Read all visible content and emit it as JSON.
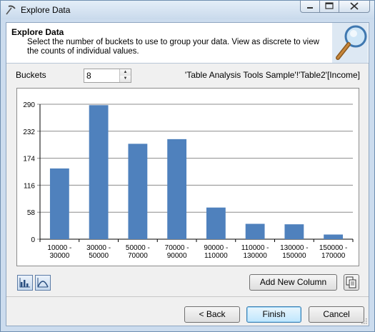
{
  "window": {
    "title": "Explore Data"
  },
  "header": {
    "title": "Explore Data",
    "description": "Select the number of buckets to use to group your data.  View as discrete to view the counts of individual values."
  },
  "buckets": {
    "label": "Buckets",
    "value": "8"
  },
  "source_label": "'Table Analysis Tools Sample'!'Table2'[Income]",
  "colors": {
    "bar": "#4f81bd",
    "finish_border": "#3c7fb1"
  },
  "chart_data": {
    "type": "bar",
    "categories": [
      "10000 - 30000",
      "30000 - 50000",
      "50000 - 70000",
      "70000 - 90000",
      "90000 - 110000",
      "110000 - 130000",
      "130000 - 150000",
      "150000 - 170000"
    ],
    "category_lines": [
      [
        "10000 -",
        "30000"
      ],
      [
        "30000 -",
        "50000"
      ],
      [
        "50000 -",
        "70000"
      ],
      [
        "70000 -",
        "90000"
      ],
      [
        "90000 -",
        "110000"
      ],
      [
        "110000 -",
        "130000"
      ],
      [
        "130000 -",
        "150000"
      ],
      [
        "150000 -",
        "170000"
      ]
    ],
    "values": [
      152,
      288,
      205,
      215,
      68,
      33,
      32,
      10
    ],
    "yticks": [
      0,
      58,
      116,
      174,
      232,
      290
    ],
    "ylim": [
      0,
      290
    ],
    "grid": true,
    "legend": "none"
  },
  "buttons": {
    "add_column": "Add New Column",
    "back": "< Back",
    "finish": "Finish",
    "cancel": "Cancel"
  },
  "icons": {
    "title": "explore-pick-icon",
    "header": "magnifier-icon",
    "bar_view": "bar-chart-view-icon",
    "curve_view": "curve-view-icon",
    "copy": "copy-icon"
  }
}
